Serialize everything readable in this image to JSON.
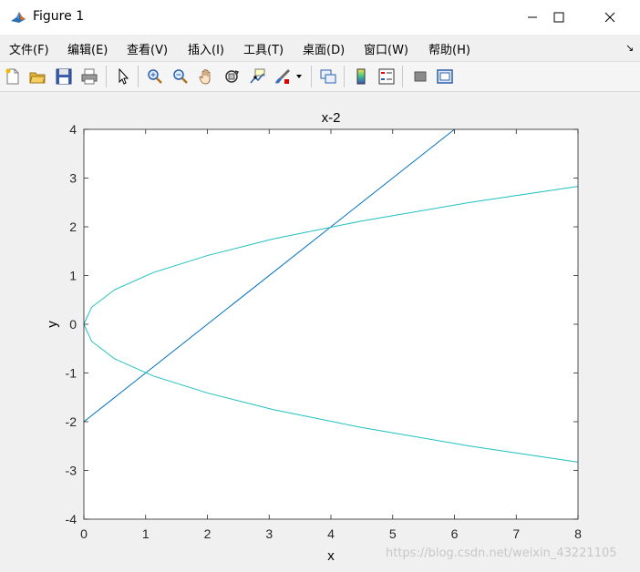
{
  "window": {
    "title": "Figure 1",
    "controls": [
      "minimize",
      "maximize",
      "close"
    ]
  },
  "menu": {
    "items": [
      "文件(F)",
      "编辑(E)",
      "查看(V)",
      "插入(I)",
      "工具(T)",
      "桌面(D)",
      "窗口(W)",
      "帮助(H)"
    ],
    "overflow_arrow": "↘"
  },
  "toolbar": {
    "buttons": [
      "new-figure-icon",
      "open-file-icon",
      "save-icon",
      "print-icon",
      "pointer-icon",
      "zoom-in-icon",
      "zoom-out-icon",
      "pan-hand-icon",
      "rotate-3d-icon",
      "data-cursor-icon",
      "brush-icon",
      "brush-dropdown-icon",
      "link-plot-icon",
      "colorbar-icon",
      "legend-icon",
      "hide-plot-tools-icon",
      "show-plot-tools-icon"
    ]
  },
  "chart_data": {
    "type": "line",
    "title": "x-2",
    "xlabel": "x",
    "ylabel": "y",
    "xlim": [
      0,
      8
    ],
    "ylim": [
      -4,
      4
    ],
    "xticks": [
      "0",
      "1",
      "2",
      "3",
      "4",
      "5",
      "6",
      "7",
      "8"
    ],
    "yticks": [
      "4",
      "3",
      "2",
      "1",
      "0",
      "-1",
      "-2",
      "-3",
      "-4"
    ],
    "grid": false,
    "series": [
      {
        "color": "#0072bd",
        "x": [
          0,
          6
        ],
        "y": [
          -2,
          4
        ]
      },
      {
        "color": "#1fbfbf",
        "x": [
          8,
          6.25,
          4.5,
          3.06,
          2,
          1.12,
          0.5,
          0.125,
          0,
          0.125,
          0.5,
          1.12,
          2,
          3.06,
          4.5,
          6.25,
          8
        ],
        "y": [
          2.83,
          2.5,
          2.12,
          1.75,
          1.41,
          1.06,
          0.71,
          0.35,
          0,
          -0.35,
          -0.71,
          -1.06,
          -1.41,
          -1.75,
          -2.12,
          -2.5,
          -2.83
        ]
      }
    ]
  },
  "watermark": "https://blog.csdn.net/weixin_43221105"
}
